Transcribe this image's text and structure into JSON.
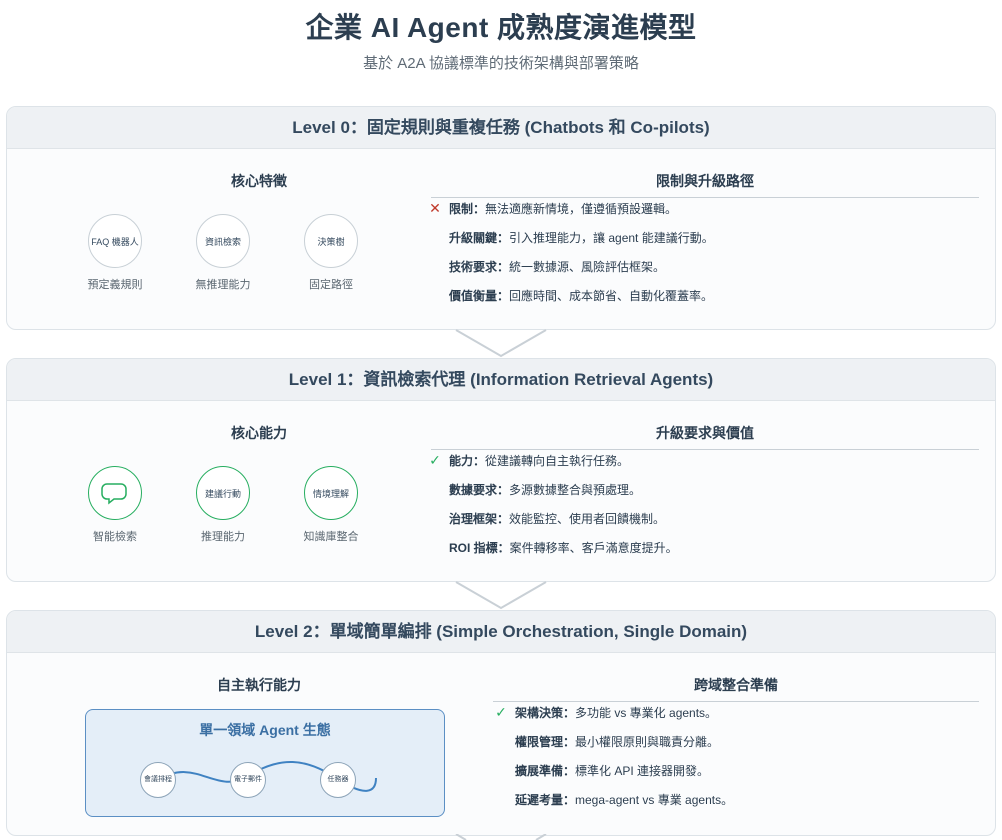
{
  "header": {
    "title": "企業 AI Agent 成熟度演進模型",
    "subtitle": "基於 A2A 協議標準的技術架構與部署策略"
  },
  "levels": [
    {
      "title": "Level 0：固定規則與重複任務 (Chatbots 和 Co-pilots)",
      "left_title": "核心特徵",
      "nodes": [
        {
          "inner": "FAQ 機器人",
          "label": "預定義規則"
        },
        {
          "inner": "資訊檢索",
          "label": "無推理能力"
        },
        {
          "inner": "決策樹",
          "label": "固定路徑"
        }
      ],
      "right_title": "限制與升級路徑",
      "items": [
        {
          "key": "限制：",
          "text": "無法適應新情境，僅遵循預設邏輯。",
          "icon": "x-icon"
        },
        {
          "key": "升級關鍵：",
          "text": "引入推理能力，讓 agent 能建議行動。"
        },
        {
          "key": "技術要求：",
          "text": "統一數據源、風險評估框架。"
        },
        {
          "key": "價值衡量：",
          "text": "回應時間、成本節省、自動化覆蓋率。"
        }
      ]
    },
    {
      "title": "Level 1：資訊檢索代理 (Information Retrieval Agents)",
      "left_title": "核心能力",
      "nodes": [
        {
          "inner": "",
          "label": "智能檢索",
          "icon": "chat-bubble-icon"
        },
        {
          "inner": "建議行動",
          "label": "推理能力"
        },
        {
          "inner": "情境理解",
          "label": "知識庫整合"
        }
      ],
      "right_title": "升級要求與價值",
      "items": [
        {
          "key": "能力：",
          "text": "從建議轉向自主執行任務。",
          "icon": "check-icon"
        },
        {
          "key": "數據要求：",
          "text": "多源數據整合與預處理。"
        },
        {
          "key": "治理框架：",
          "text": "效能監控、使用者回饋機制。"
        },
        {
          "key": "ROI 指標：",
          "text": "案件轉移率、客戶滿意度提升。"
        }
      ]
    },
    {
      "title": "Level 2：單域簡單編排 (Simple Orchestration, Single Domain)",
      "left_title": "自主執行能力",
      "ecosystem": {
        "title": "單一領域 Agent 生態",
        "nodes": [
          "會議排程",
          "電子郵件",
          "任務器"
        ]
      },
      "right_title": "跨域整合準備",
      "items": [
        {
          "key": "架構決策：",
          "text": "多功能 vs 專業化 agents。",
          "icon": "check-icon"
        },
        {
          "key": "權限管理：",
          "text": "最小權限原則與職責分離。"
        },
        {
          "key": "擴展準備：",
          "text": "標準化 API 連接器開發。"
        },
        {
          "key": "延遲考量：",
          "text": "mega-agent vs 專業 agents。"
        }
      ]
    }
  ],
  "colors": {
    "accent_green": "#27ae60",
    "accent_red": "#c0392b",
    "accent_blue": "#3b6fa3",
    "title_text": "#2c3e50"
  }
}
